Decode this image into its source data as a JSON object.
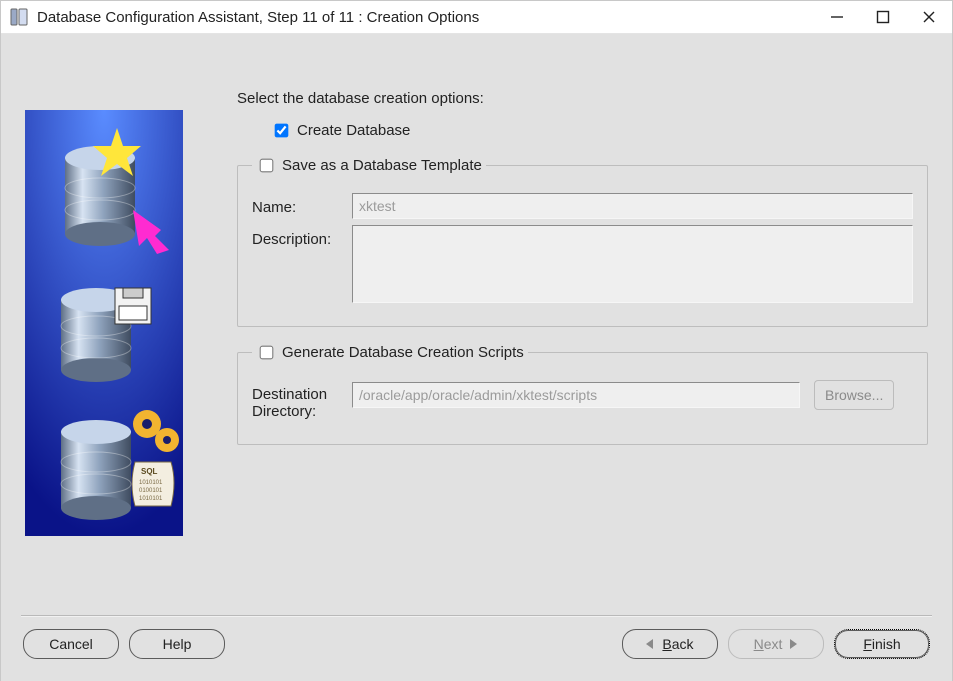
{
  "window": {
    "title": "Database Configuration Assistant, Step 11 of 11 : Creation Options"
  },
  "main": {
    "instruction": "Select the database creation options:",
    "createDatabaseLabel": "Create Database",
    "createDatabaseChecked": true,
    "templateGroup": {
      "legend": "Save as a Database Template",
      "checked": false,
      "nameLabel": "Name:",
      "nameValue": "xktest",
      "descriptionLabel": "Description:",
      "descriptionValue": ""
    },
    "scriptsGroup": {
      "legend": "Generate Database Creation Scripts",
      "checked": false,
      "destLabel": "Destination\nDirectory:",
      "destValue": "/oracle/app/oracle/admin/xktest/scripts",
      "browseLabel": "Browse..."
    }
  },
  "buttons": {
    "cancel": "Cancel",
    "help": "Help",
    "back": "Back",
    "next": "Next",
    "finish": "Finish"
  }
}
